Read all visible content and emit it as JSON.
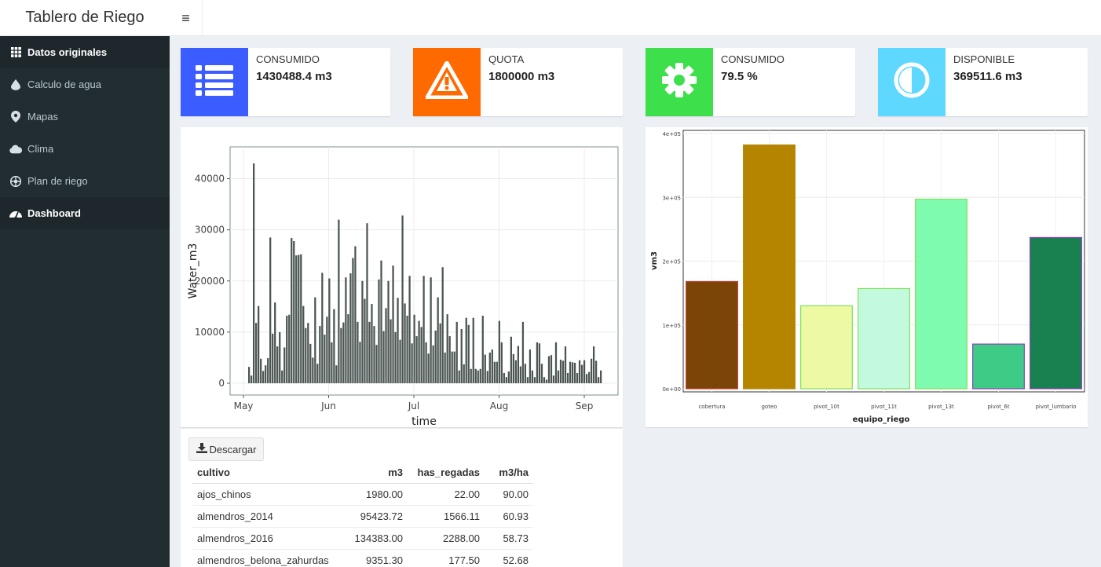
{
  "header": {
    "title": "Tablero de Riego",
    "toggle_glyph": "≡"
  },
  "sidebar": {
    "items": [
      {
        "label": "Datos originales",
        "icon": "grid-icon"
      },
      {
        "label": "Calculo de agua",
        "icon": "water-drop-icon"
      },
      {
        "label": "Mapas",
        "icon": "map-marker-icon"
      },
      {
        "label": "Clima",
        "icon": "cloud-icon"
      },
      {
        "label": "Plan de riego",
        "icon": "globe-icon"
      },
      {
        "label": "Dashboard",
        "icon": "dashboard-icon"
      }
    ]
  },
  "infoboxes": [
    {
      "label": "CONSUMIDO",
      "value": "1430488.4 m3",
      "color": "#3b5cff",
      "icon": "list-icon"
    },
    {
      "label": "QUOTA",
      "value": "1800000 m3",
      "color": "#ff6a00",
      "icon": "warning-icon"
    },
    {
      "label": "CONSUMIDO",
      "value": "79.5 %",
      "color": "#3de04a",
      "icon": "gear-icon"
    },
    {
      "label": "DISPONIBLE",
      "value": "369511.6 m3",
      "color": "#5fd8ff",
      "icon": "adjust-icon"
    }
  ],
  "chart_data": [
    {
      "type": "bar",
      "xlabel": "time",
      "ylabel": "Water_m3",
      "x_ticks": [
        "May",
        "Jun",
        "Jul",
        "Aug",
        "Sep"
      ],
      "y_ticks": [
        "0",
        "10000",
        "20000",
        "30000",
        "40000"
      ],
      "ylim": [
        0,
        45000
      ],
      "bar_color": "#4a5552",
      "values": [
        3200,
        1500,
        43000,
        11800,
        15100,
        4800,
        2400,
        3500,
        4900,
        28500,
        9700,
        15800,
        7200,
        10000,
        2500,
        7000,
        13200,
        13400,
        28400,
        27800,
        25000,
        25100,
        25200,
        15100,
        10800,
        11800,
        7700,
        5000,
        16800,
        3800,
        11200,
        21600,
        9500,
        13000,
        20500,
        8000,
        14500,
        3500,
        32000,
        10800,
        11900,
        20700,
        13500,
        21500,
        24500,
        26800,
        12000,
        8100,
        20000,
        16500,
        31300,
        12000,
        15500,
        11200,
        7500,
        20300,
        24000,
        10200,
        14700,
        20000,
        12500,
        23000,
        10000,
        16700,
        8500,
        32800,
        15600,
        13200,
        21000,
        7800,
        13400,
        9200,
        12200,
        11000,
        21000,
        8000,
        5800,
        20700,
        7400,
        10300,
        16800,
        11700,
        22700,
        6000,
        13500,
        9200,
        6200,
        6200,
        12000,
        2500,
        10600,
        3700,
        12800,
        11400,
        2800,
        12800,
        2800,
        2500,
        2800,
        13200,
        5600,
        2400,
        6000,
        6600,
        4200,
        4200,
        12200,
        8000,
        2000,
        1200,
        2300,
        9100,
        5700,
        4500,
        7300,
        3300,
        12000,
        3800,
        1200,
        6600,
        2500,
        1200,
        8000,
        7800,
        3800,
        1200,
        700,
        5300,
        5500,
        1500,
        8000,
        2500,
        4600,
        4400,
        7200,
        2000,
        4200,
        4100,
        4000,
        2000,
        4500,
        3600,
        4500,
        1800,
        2200,
        4800,
        7200,
        4400,
        1200,
        2500
      ]
    },
    {
      "type": "bar",
      "xlabel": "equipo_riego",
      "ylabel": "vm3",
      "categories": [
        "cobertura",
        "goteo",
        "pivot_10t",
        "pivot_11t",
        "pivot_13t",
        "pivot_6t",
        "pivot_lumbario"
      ],
      "values": [
        168000,
        382000,
        130000,
        157000,
        297000,
        70000,
        237000
      ],
      "fill_colors": [
        "#7a4506",
        "#b58500",
        "#eef9a3",
        "#c3f9dc",
        "#7ffbb0",
        "#3ecb86",
        "#19804f"
      ],
      "stroke_colors": [
        "#c73b2a",
        "#b58500",
        "#7fe05a",
        "#7fe05a",
        "#7fe05a",
        "#8a3fbf",
        "#8a3fbf"
      ],
      "y_ticks": [
        "0e+00",
        "1e+05",
        "2e+05",
        "3e+05",
        "4e+05"
      ],
      "ylim": [
        0,
        400000
      ]
    }
  ],
  "table": {
    "download_label": "Descargar",
    "headers": [
      "cultivo",
      "m3",
      "has_regadas",
      "m3/ha"
    ],
    "rows": [
      [
        "ajos_chinos",
        "1980.00",
        "22.00",
        "90.00"
      ],
      [
        "almendros_2014",
        "95423.72",
        "1566.11",
        "60.93"
      ],
      [
        "almendros_2016",
        "134383.00",
        "2288.00",
        "58.73"
      ],
      [
        "almendros_belona_zahurdas",
        "9351.30",
        "177.50",
        "52.68"
      ]
    ]
  }
}
